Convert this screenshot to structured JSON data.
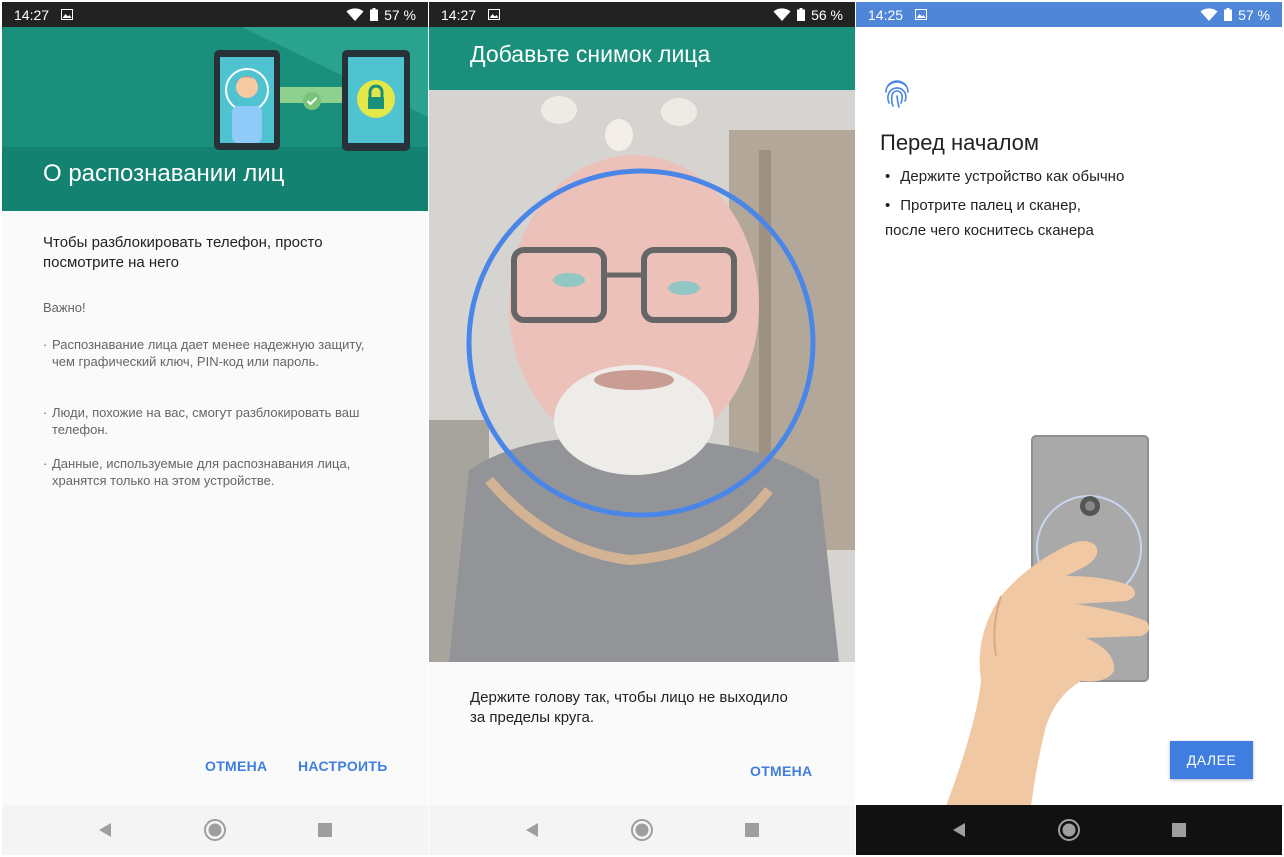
{
  "colors": {
    "teal": "#1a8f7c",
    "accent": "#3f7ee0",
    "circle": "#4a86e8",
    "statusbar_blue": "#4f86d8"
  },
  "panels": [
    {
      "status": {
        "time": "14:27",
        "battery": "57 %"
      },
      "title": "О распознавании лиц",
      "lead": "Чтобы разблокировать телефон, просто посмотрите на него",
      "important": "Важно!",
      "bullets": [
        "Распознавание лица дает менее надежную защиту, чем графический ключ, PIN-код или пароль.",
        "Люди, похожие на вас, смогут разблокировать ваш телефон.",
        "Данные, используемые для распознавания лица, хранятся только на этом устройстве."
      ],
      "cancel_label": "ОТМЕНА",
      "setup_label": "НАСТРОИТЬ"
    },
    {
      "status": {
        "time": "14:27",
        "battery": "56 %"
      },
      "title": "Добавьте снимок лица",
      "hint": "Держите голову так, чтобы лицо не выходило за пределы круга.",
      "cancel_label": "ОТМЕНА"
    },
    {
      "status": {
        "time": "14:25",
        "battery": "57 %"
      },
      "title": "Перед началом",
      "items": [
        "Держите устройство как обычно",
        "Протрите палец и сканер,"
      ],
      "continuation": "после чего коснитесь сканера",
      "next_label": "ДАЛЕЕ"
    }
  ],
  "icons": [
    "gallery-icon",
    "wifi-icon",
    "battery-icon",
    "fingerprint-icon",
    "back-icon",
    "home-icon",
    "recents-icon",
    "lock-icon",
    "check-icon"
  ]
}
